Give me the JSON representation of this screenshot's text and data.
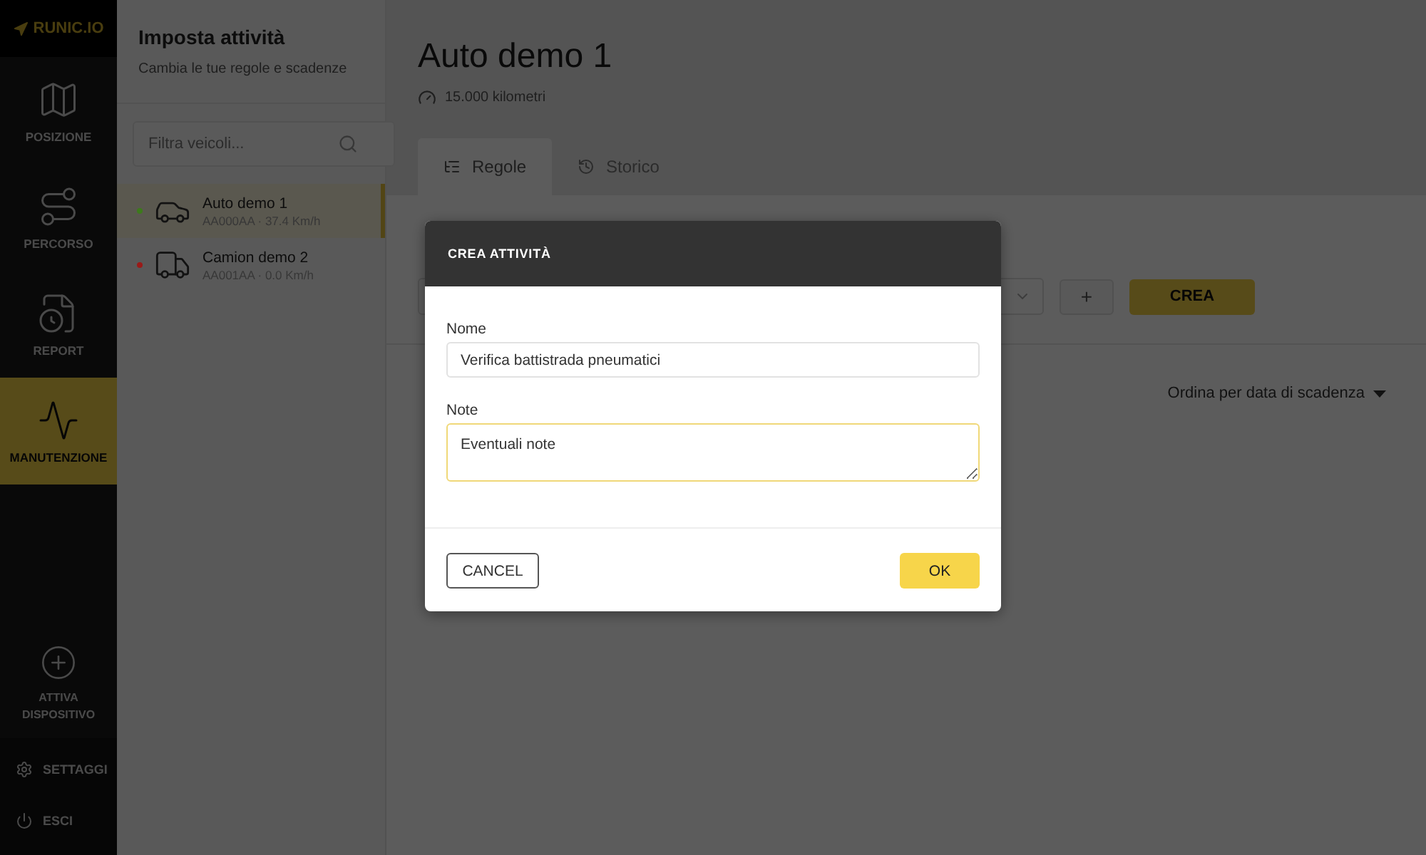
{
  "brand": "RUNIC.IO",
  "nav": {
    "items": [
      {
        "label": "POSIZIONE",
        "selected": false
      },
      {
        "label": "PERCORSO",
        "selected": false
      },
      {
        "label": "REPORT",
        "selected": false
      },
      {
        "label": "MANUTENZIONE",
        "selected": true
      }
    ],
    "activate": {
      "label": "ATTIVA DISPOSITIVO"
    },
    "footer": [
      {
        "label": "SETTAGGI"
      },
      {
        "label": "ESCI"
      }
    ]
  },
  "panel": {
    "title": "Imposta attività",
    "subtitle": "Cambia le tue regole e scadenze",
    "search": {
      "placeholder": "Filtra veicoli..."
    },
    "vehicles": [
      {
        "name": "Auto demo 1",
        "detail": "AA000AA · 37.4 Km/h",
        "color": "#3d7a1c",
        "kind": "car",
        "selected": true
      },
      {
        "name": "Camion demo 2",
        "detail": "AA001AA · 0.0 Km/h",
        "color": "#9a1a18",
        "kind": "truck",
        "selected": false
      }
    ]
  },
  "main": {
    "title": "Auto demo 1",
    "odometer": "15.000 kilometri",
    "tabs": [
      {
        "label": "Regole",
        "selected": true
      },
      {
        "label": "Storico",
        "selected": false
      }
    ],
    "form": {
      "add": "+",
      "create": "CREA"
    },
    "sort": "Ordina per data di scadenza"
  },
  "dialog": {
    "title": "CREA ATTIVITÀ",
    "fields": [
      {
        "label": "Nome",
        "kind": "input",
        "value": "Verifica battistrada pneumatici",
        "focused": false
      },
      {
        "label": "Note",
        "kind": "textarea",
        "value": "Eventuali note",
        "focused": true
      }
    ],
    "cancel": "CANCEL",
    "ok": "OK"
  }
}
